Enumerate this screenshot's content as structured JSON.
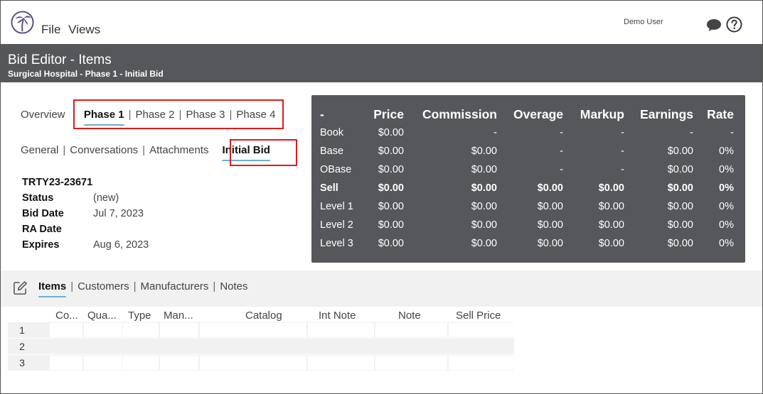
{
  "menu": {
    "file": "File",
    "views": "Views"
  },
  "user": {
    "name": "Demo User"
  },
  "icons": {
    "logo": "palm-tree-logo-icon",
    "chat": "chat-bubble-icon",
    "help": "help-circle-icon",
    "edit": "edit-icon"
  },
  "colors": {
    "band": "#55575a",
    "accent_underline": "#6aaed6",
    "highlight_box": "#e01b1b",
    "panel": "#55575a"
  },
  "header": {
    "title": "Bid Editor - Items",
    "subtitle": "Surgical Hospital - Phase 1 - Initial Bid"
  },
  "phase_nav": {
    "overview": "Overview",
    "phases": [
      "Phase 1",
      "Phase 2",
      "Phase 3",
      "Phase 4"
    ],
    "active": "Phase 1"
  },
  "section_nav": {
    "tabs": [
      "General",
      "Conversations",
      "Attachments",
      "Initial Bid"
    ],
    "active": "Initial Bid"
  },
  "bid": {
    "number": "TRTY23-23671",
    "status_label": "Status",
    "status": "(new)",
    "bid_date_label": "Bid Date",
    "bid_date": "Jul 7, 2023",
    "ra_date_label": "RA Date",
    "ra_date": "",
    "expires_label": "Expires",
    "expires": "Aug 6, 2023"
  },
  "pricing": {
    "columns": [
      "-",
      "Price",
      "Commission",
      "Overage",
      "Markup",
      "Earnings",
      "Rate"
    ],
    "rows": [
      [
        "Book",
        "$0.00",
        "-",
        "-",
        "-",
        "-",
        "-"
      ],
      [
        "Base",
        "$0.00",
        "$0.00",
        "-",
        "-",
        "$0.00",
        "0%"
      ],
      [
        "OBase",
        "$0.00",
        "$0.00",
        "-",
        "-",
        "$0.00",
        "0%"
      ],
      [
        "Sell",
        "$0.00",
        "$0.00",
        "$0.00",
        "$0.00",
        "$0.00",
        "0%"
      ],
      [
        "Level 1",
        "$0.00",
        "$0.00",
        "$0.00",
        "$0.00",
        "$0.00",
        "0%"
      ],
      [
        "Level 2",
        "$0.00",
        "$0.00",
        "$0.00",
        "$0.00",
        "$0.00",
        "0%"
      ],
      [
        "Level 3",
        "$0.00",
        "$0.00",
        "$0.00",
        "$0.00",
        "$0.00",
        "0%"
      ]
    ]
  },
  "lower_tabs": {
    "tabs": [
      "Items",
      "Customers",
      "Manufacturers",
      "Notes"
    ],
    "active": "Items"
  },
  "items_grid": {
    "columns": [
      "Co...",
      "Qua...",
      "Type",
      "Man...",
      "Catalog",
      "Int Note",
      "Note",
      "Sell Price"
    ],
    "row_numbers": [
      "1",
      "2",
      "3"
    ]
  }
}
